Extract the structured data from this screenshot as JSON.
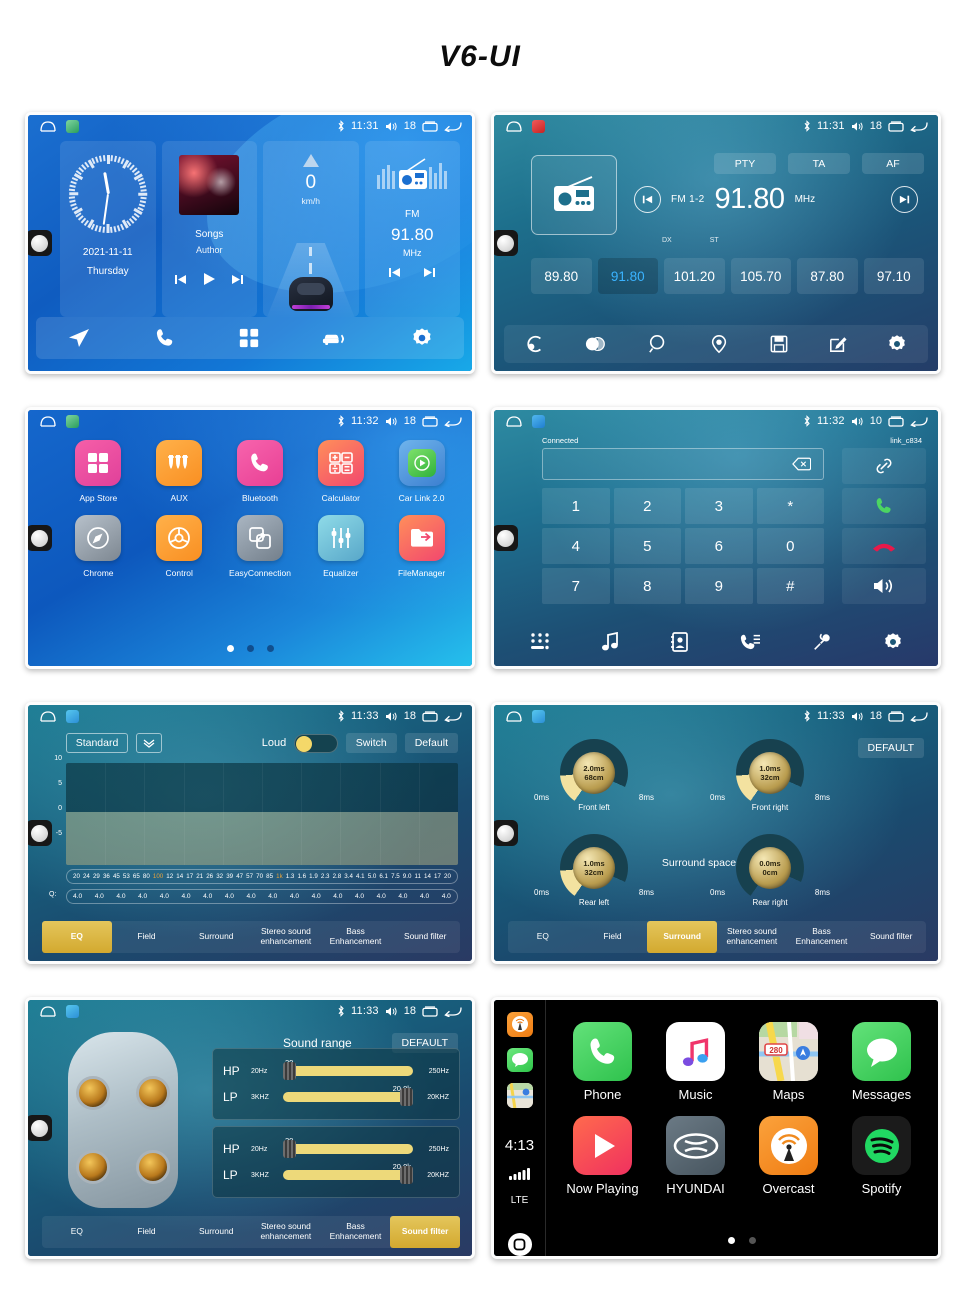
{
  "title": "V6-UI",
  "statusbar": {
    "bluetooth_icon": "bluetooth-icon",
    "volume_icon": "speaker-icon",
    "recents_icon": "recents-icon",
    "back_icon": "back-icon",
    "home_icon": "home-outline-icon",
    "times": {
      "t1131": "11:31",
      "t1132": "11:32",
      "t1133": "11:33"
    },
    "volumes": {
      "v18": "18",
      "v10": "10"
    }
  },
  "home": {
    "clock": {
      "date": "2021-11-11",
      "day": "Thursday"
    },
    "music": {
      "title": "Songs",
      "artist": "Author",
      "prev": "prev-track-icon",
      "play": "play-icon",
      "next": "next-track-icon"
    },
    "speed": {
      "value": "0",
      "unit": "km/h"
    },
    "radio": {
      "band": "FM",
      "freq": "91.80",
      "unit": "MHz",
      "prev": "prev-station-icon",
      "next": "next-station-icon"
    },
    "dock": [
      {
        "name": "navigation-icon"
      },
      {
        "name": "phone-icon"
      },
      {
        "name": "apps-grid-icon"
      },
      {
        "name": "car-link-icon"
      },
      {
        "name": "settings-gear-icon"
      }
    ]
  },
  "radio": {
    "rds_buttons": [
      {
        "label": "PTY"
      },
      {
        "label": "TA"
      },
      {
        "label": "AF"
      }
    ],
    "band": "FM 1-2",
    "freq": "91.80",
    "unit": "MHz",
    "dx": "DX",
    "st": "ST",
    "presets": [
      {
        "freq": "89.80",
        "active": false
      },
      {
        "freq": "91.80",
        "active": true
      },
      {
        "freq": "101.20",
        "active": false
      },
      {
        "freq": "105.70",
        "active": false
      },
      {
        "freq": "87.80",
        "active": false
      },
      {
        "freq": "97.10",
        "active": false
      }
    ],
    "dock": [
      {
        "name": "band-switch-icon"
      },
      {
        "name": "stereo-toggle-icon"
      },
      {
        "name": "search-icon"
      },
      {
        "name": "scan-icon"
      },
      {
        "name": "save-icon"
      },
      {
        "name": "edit-icon"
      },
      {
        "name": "settings-gear-icon"
      }
    ]
  },
  "apps": {
    "items": [
      {
        "label": "App Store",
        "icon": "app-store-icon",
        "color1": "#f65fa8",
        "color2": "#e0409a"
      },
      {
        "label": "AUX",
        "icon": "aux-icon",
        "color1": "#ffb14a",
        "color2": "#f98f22"
      },
      {
        "label": "Bluetooth",
        "icon": "bluetooth-phone-icon",
        "color1": "#f764ad",
        "color2": "#e83f94"
      },
      {
        "label": "Calculator",
        "icon": "calculator-icon",
        "color1": "#ff8f5a",
        "color2": "#f2476e"
      },
      {
        "label": "Car Link 2.0",
        "icon": "car-link-icon",
        "color1": "#5fa8e8",
        "color2": "#3c7fd0"
      },
      {
        "label": "Chrome",
        "icon": "chrome-icon",
        "color1": "#a6b0ba",
        "color2": "#7d8791"
      },
      {
        "label": "Control",
        "icon": "steering-wheel-icon",
        "color1": "#ffb14a",
        "color2": "#f98f22"
      },
      {
        "label": "EasyConnection",
        "icon": "easyconnection-icon",
        "color1": "#9aa6b2",
        "color2": "#737f8b"
      },
      {
        "label": "Equalizer",
        "icon": "equalizer-icon",
        "color1": "#7fd0e0",
        "color2": "#58a7c9"
      },
      {
        "label": "FileManager",
        "icon": "file-manager-icon",
        "color1": "#ff8f5a",
        "color2": "#f2476e"
      }
    ],
    "page_dots": 3,
    "active_dot": 0
  },
  "bluetooth": {
    "status": "Connected",
    "device": "link_c834",
    "input_value": "",
    "backspace_icon": "backspace-icon",
    "keys": [
      "1",
      "2",
      "3",
      "*",
      "4",
      "5",
      "6",
      "0",
      "7",
      "8",
      "9",
      "#"
    ],
    "side_buttons": [
      {
        "name": "link-icon"
      },
      {
        "name": "call-answer-icon"
      },
      {
        "name": "call-end-icon"
      },
      {
        "name": "speaker-icon"
      }
    ],
    "dock": [
      {
        "name": "dialpad-icon"
      },
      {
        "name": "music-note-icon"
      },
      {
        "name": "contacts-icon"
      },
      {
        "name": "call-history-icon"
      },
      {
        "name": "bt-connect-icon"
      },
      {
        "name": "settings-gear-icon"
      }
    ]
  },
  "audio": {
    "tabs": [
      {
        "label": "EQ"
      },
      {
        "label": "Field"
      },
      {
        "label": "Surround"
      },
      {
        "label": "Stereo sound enhancement"
      },
      {
        "label": "Bass Enhancement"
      },
      {
        "label": "Sound filter"
      }
    ],
    "eq": {
      "preset": "Standard",
      "caret_icon": "chevron-down-icon",
      "loud_label": "Loud",
      "loud_on": false,
      "switch_label": "Switch",
      "default_label": "Default",
      "y_labels": [
        "10",
        "5",
        "0",
        "-5"
      ],
      "freq_labels": [
        "20",
        "24",
        "29",
        "36",
        "45",
        "53",
        "65",
        "80",
        "100",
        "12",
        "14",
        "17",
        "21",
        "26",
        "32",
        "39",
        "47",
        "57",
        "70",
        "85",
        "1k",
        "1.3",
        "1.6",
        "1.9",
        "2.3",
        "2.8",
        "3.4",
        "4.1",
        "5.0",
        "6.1",
        "7.5",
        "9.0",
        "11",
        "14",
        "17",
        "20"
      ],
      "highlighted_freqs": [
        "100",
        "1k"
      ],
      "q_label": "Q:",
      "q_values": [
        "4.0",
        "4.0",
        "4.0",
        "4.0",
        "4.0",
        "4.0",
        "4.0",
        "4.0",
        "4.0",
        "4.0",
        "4.0",
        "4.0",
        "4.0",
        "4.0",
        "4.0",
        "4.0",
        "4.0",
        "4.0"
      ]
    },
    "surround": {
      "title": "Surround space",
      "default_label": "DEFAULT",
      "knobs": [
        {
          "name": "Front left",
          "delay": "2.0ms",
          "distance": "68cm",
          "min": "0ms",
          "max": "8ms"
        },
        {
          "name": "Front right",
          "delay": "1.0ms",
          "distance": "32cm",
          "min": "0ms",
          "max": "8ms"
        },
        {
          "name": "Rear left",
          "delay": "1.0ms",
          "distance": "32cm",
          "min": "0ms",
          "max": "8ms"
        },
        {
          "name": "Rear right",
          "delay": "0.0ms",
          "distance": "0cm",
          "min": "0ms",
          "max": "8ms"
        }
      ]
    },
    "filter": {
      "title": "Sound range",
      "default_label": "DEFAULT",
      "rows": [
        {
          "tag": "HP",
          "min": "20Hz",
          "max": "250Hz",
          "value": "20",
          "pos": "left"
        },
        {
          "tag": "LP",
          "min": "3KHZ",
          "max": "20KHZ",
          "value": "20.0k",
          "pos": "right"
        },
        {
          "tag": "HP",
          "min": "20Hz",
          "max": "250Hz",
          "value": "20",
          "pos": "left"
        },
        {
          "tag": "LP",
          "min": "3KHZ",
          "max": "20KHZ",
          "value": "20.0k",
          "pos": "right"
        }
      ]
    }
  },
  "carplay": {
    "time": "4:13",
    "signal": "signal-bars-icon",
    "network": "LTE",
    "home_icon": "carplay-home-icon",
    "sidebar_icons": [
      {
        "name": "overcast-icon",
        "color": "#f08a1e"
      },
      {
        "name": "messages-icon",
        "color": "#4cd562"
      },
      {
        "name": "maps-icon",
        "color": "#e9e4d8"
      }
    ],
    "apps": [
      {
        "label": "Phone",
        "icon": "phone-icon"
      },
      {
        "label": "Music",
        "icon": "music-icon"
      },
      {
        "label": "Maps",
        "icon": "maps-icon"
      },
      {
        "label": "Messages",
        "icon": "messages-icon"
      },
      {
        "label": "Now Playing",
        "icon": "now-playing-icon"
      },
      {
        "label": "HYUNDAI",
        "icon": "hyundai-icon"
      },
      {
        "label": "Overcast",
        "icon": "overcast-icon"
      },
      {
        "label": "Spotify",
        "icon": "spotify-icon"
      }
    ],
    "page_dots": 2,
    "active_dot": 0
  },
  "colors": {
    "accent_gold": "#d8b63f",
    "accent_blue": "#3ab3ff",
    "carplay_green": "#4cd562"
  }
}
